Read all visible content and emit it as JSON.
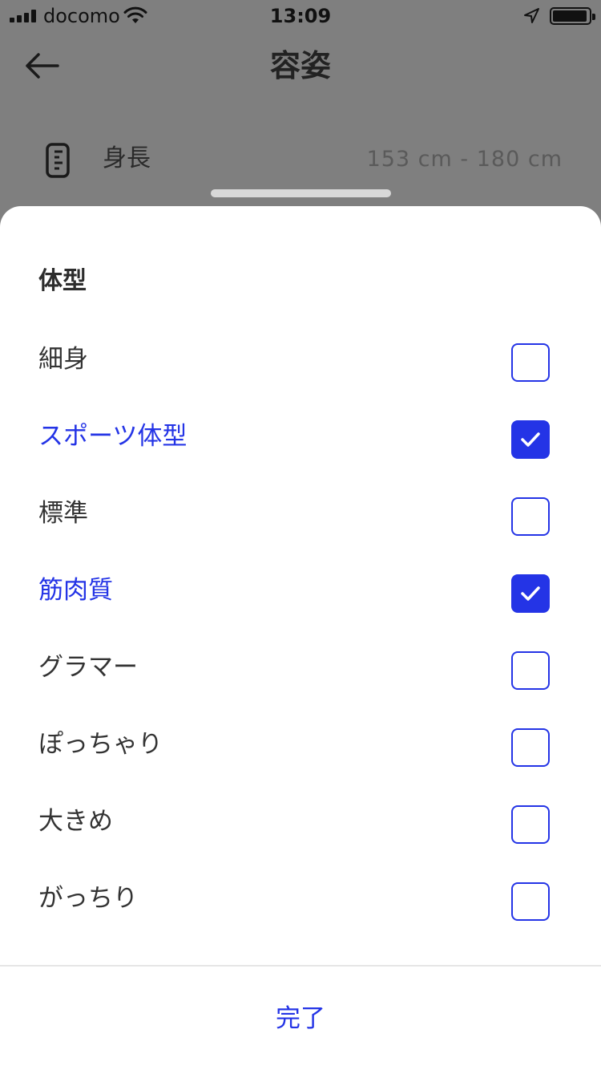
{
  "status_bar": {
    "carrier": "docomo",
    "time": "13:09"
  },
  "nav": {
    "title": "容姿"
  },
  "height_row": {
    "label": "身長",
    "value": "153 cm - 180 cm"
  },
  "sheet": {
    "title": "体型",
    "options": [
      {
        "label": "細身",
        "checked": false
      },
      {
        "label": "スポーツ体型",
        "checked": true
      },
      {
        "label": "標準",
        "checked": false
      },
      {
        "label": "筋肉質",
        "checked": true
      },
      {
        "label": "グラマー",
        "checked": false
      },
      {
        "label": "ぽっちゃり",
        "checked": false
      },
      {
        "label": "大きめ",
        "checked": false
      },
      {
        "label": "がっちり",
        "checked": false
      }
    ],
    "done_label": "完了"
  },
  "colors": {
    "accent": "#2434e6",
    "overlay": "#7f7f7f"
  }
}
